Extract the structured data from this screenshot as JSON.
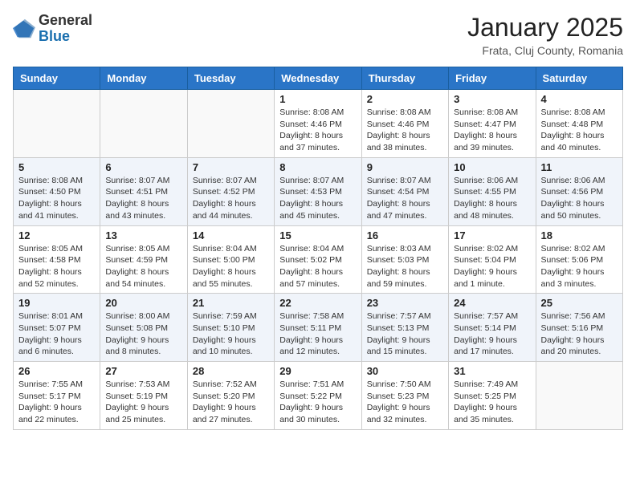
{
  "header": {
    "logo_general": "General",
    "logo_blue": "Blue",
    "month_title": "January 2025",
    "location": "Frata, Cluj County, Romania"
  },
  "days_of_week": [
    "Sunday",
    "Monday",
    "Tuesday",
    "Wednesday",
    "Thursday",
    "Friday",
    "Saturday"
  ],
  "weeks": [
    [
      {
        "day": "",
        "info": ""
      },
      {
        "day": "",
        "info": ""
      },
      {
        "day": "",
        "info": ""
      },
      {
        "day": "1",
        "info": "Sunrise: 8:08 AM\nSunset: 4:46 PM\nDaylight: 8 hours and 37 minutes."
      },
      {
        "day": "2",
        "info": "Sunrise: 8:08 AM\nSunset: 4:46 PM\nDaylight: 8 hours and 38 minutes."
      },
      {
        "day": "3",
        "info": "Sunrise: 8:08 AM\nSunset: 4:47 PM\nDaylight: 8 hours and 39 minutes."
      },
      {
        "day": "4",
        "info": "Sunrise: 8:08 AM\nSunset: 4:48 PM\nDaylight: 8 hours and 40 minutes."
      }
    ],
    [
      {
        "day": "5",
        "info": "Sunrise: 8:08 AM\nSunset: 4:50 PM\nDaylight: 8 hours and 41 minutes."
      },
      {
        "day": "6",
        "info": "Sunrise: 8:07 AM\nSunset: 4:51 PM\nDaylight: 8 hours and 43 minutes."
      },
      {
        "day": "7",
        "info": "Sunrise: 8:07 AM\nSunset: 4:52 PM\nDaylight: 8 hours and 44 minutes."
      },
      {
        "day": "8",
        "info": "Sunrise: 8:07 AM\nSunset: 4:53 PM\nDaylight: 8 hours and 45 minutes."
      },
      {
        "day": "9",
        "info": "Sunrise: 8:07 AM\nSunset: 4:54 PM\nDaylight: 8 hours and 47 minutes."
      },
      {
        "day": "10",
        "info": "Sunrise: 8:06 AM\nSunset: 4:55 PM\nDaylight: 8 hours and 48 minutes."
      },
      {
        "day": "11",
        "info": "Sunrise: 8:06 AM\nSunset: 4:56 PM\nDaylight: 8 hours and 50 minutes."
      }
    ],
    [
      {
        "day": "12",
        "info": "Sunrise: 8:05 AM\nSunset: 4:58 PM\nDaylight: 8 hours and 52 minutes."
      },
      {
        "day": "13",
        "info": "Sunrise: 8:05 AM\nSunset: 4:59 PM\nDaylight: 8 hours and 54 minutes."
      },
      {
        "day": "14",
        "info": "Sunrise: 8:04 AM\nSunset: 5:00 PM\nDaylight: 8 hours and 55 minutes."
      },
      {
        "day": "15",
        "info": "Sunrise: 8:04 AM\nSunset: 5:02 PM\nDaylight: 8 hours and 57 minutes."
      },
      {
        "day": "16",
        "info": "Sunrise: 8:03 AM\nSunset: 5:03 PM\nDaylight: 8 hours and 59 minutes."
      },
      {
        "day": "17",
        "info": "Sunrise: 8:02 AM\nSunset: 5:04 PM\nDaylight: 9 hours and 1 minute."
      },
      {
        "day": "18",
        "info": "Sunrise: 8:02 AM\nSunset: 5:06 PM\nDaylight: 9 hours and 3 minutes."
      }
    ],
    [
      {
        "day": "19",
        "info": "Sunrise: 8:01 AM\nSunset: 5:07 PM\nDaylight: 9 hours and 6 minutes."
      },
      {
        "day": "20",
        "info": "Sunrise: 8:00 AM\nSunset: 5:08 PM\nDaylight: 9 hours and 8 minutes."
      },
      {
        "day": "21",
        "info": "Sunrise: 7:59 AM\nSunset: 5:10 PM\nDaylight: 9 hours and 10 minutes."
      },
      {
        "day": "22",
        "info": "Sunrise: 7:58 AM\nSunset: 5:11 PM\nDaylight: 9 hours and 12 minutes."
      },
      {
        "day": "23",
        "info": "Sunrise: 7:57 AM\nSunset: 5:13 PM\nDaylight: 9 hours and 15 minutes."
      },
      {
        "day": "24",
        "info": "Sunrise: 7:57 AM\nSunset: 5:14 PM\nDaylight: 9 hours and 17 minutes."
      },
      {
        "day": "25",
        "info": "Sunrise: 7:56 AM\nSunset: 5:16 PM\nDaylight: 9 hours and 20 minutes."
      }
    ],
    [
      {
        "day": "26",
        "info": "Sunrise: 7:55 AM\nSunset: 5:17 PM\nDaylight: 9 hours and 22 minutes."
      },
      {
        "day": "27",
        "info": "Sunrise: 7:53 AM\nSunset: 5:19 PM\nDaylight: 9 hours and 25 minutes."
      },
      {
        "day": "28",
        "info": "Sunrise: 7:52 AM\nSunset: 5:20 PM\nDaylight: 9 hours and 27 minutes."
      },
      {
        "day": "29",
        "info": "Sunrise: 7:51 AM\nSunset: 5:22 PM\nDaylight: 9 hours and 30 minutes."
      },
      {
        "day": "30",
        "info": "Sunrise: 7:50 AM\nSunset: 5:23 PM\nDaylight: 9 hours and 32 minutes."
      },
      {
        "day": "31",
        "info": "Sunrise: 7:49 AM\nSunset: 5:25 PM\nDaylight: 9 hours and 35 minutes."
      },
      {
        "day": "",
        "info": ""
      }
    ]
  ]
}
